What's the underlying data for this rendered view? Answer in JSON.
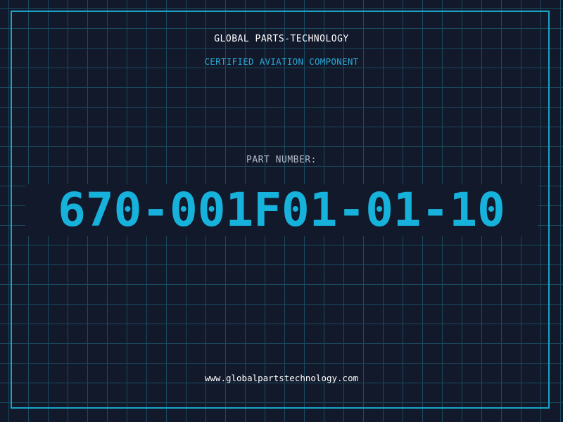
{
  "header": {
    "company": "GLOBAL PARTS-TECHNOLOGY",
    "tagline": "CERTIFIED AVIATION COMPONENT"
  },
  "part": {
    "label": "PART NUMBER:",
    "number": "670-001F01-01-10"
  },
  "footer": {
    "website": "www.globalpartstechnology.com"
  },
  "colors": {
    "background": "#12192b",
    "grid": "#1b4a5e",
    "frame": "#19a4c8",
    "accent": "#17b2dc",
    "label": "#b3bcc9",
    "text": "#ffffff"
  }
}
